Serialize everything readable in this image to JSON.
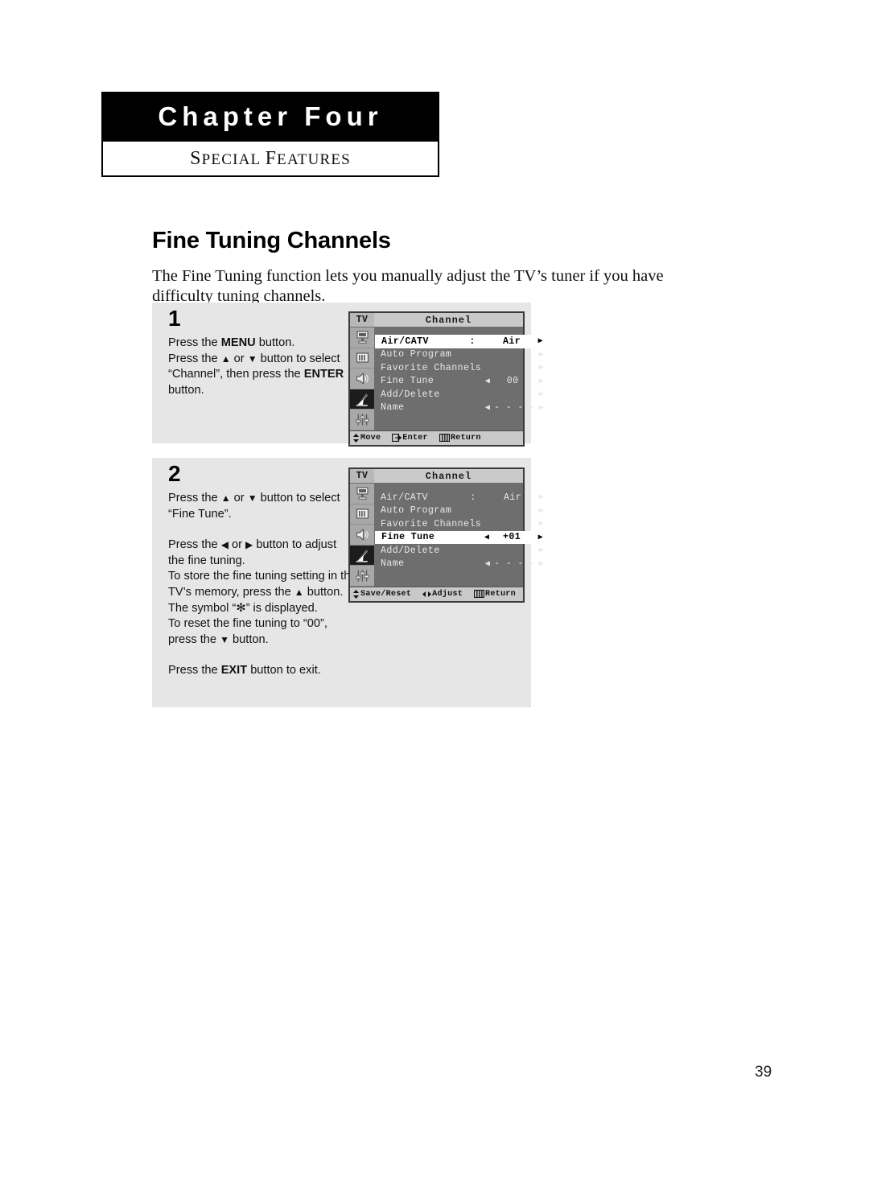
{
  "chapter": {
    "title": "Chapter Four",
    "subtitle_first": "S",
    "subtitle_rest": "PECIAL ",
    "subtitle_first2": "F",
    "subtitle_rest2": "EATURES"
  },
  "page": {
    "title": "Fine Tuning Channels",
    "intro": "The Fine Tuning function lets you manually adjust the TV’s tuner if you have difficulty tuning channels.",
    "number": "39"
  },
  "steps": [
    {
      "number": "1",
      "lines": [
        {
          "parts": [
            {
              "t": "Press the "
            },
            {
              "t": "MENU",
              "b": true
            },
            {
              "t": " button."
            }
          ]
        },
        {
          "parts": [
            {
              "t": "Press the "
            },
            {
              "t": "▲",
              "a": true
            },
            {
              "t": " or "
            },
            {
              "t": "▼",
              "a": true
            },
            {
              "t": " button to select"
            }
          ]
        },
        {
          "parts": [
            {
              "t": "“Channel”, then press the "
            },
            {
              "t": "ENTER",
              "b": true
            }
          ]
        },
        {
          "parts": [
            {
              "t": "button."
            }
          ]
        }
      ]
    },
    {
      "number": "2",
      "lines": [
        {
          "parts": [
            {
              "t": "Press the "
            },
            {
              "t": "▲",
              "a": true
            },
            {
              "t": " or "
            },
            {
              "t": "▼",
              "a": true
            },
            {
              "t": " button to select"
            }
          ]
        },
        {
          "parts": [
            {
              "t": "“Fine Tune”."
            }
          ]
        },
        {
          "gap": true
        },
        {
          "parts": [
            {
              "t": "Press the "
            },
            {
              "t": "◀",
              "a": true
            },
            {
              "t": " or "
            },
            {
              "t": "▶",
              "a": true
            },
            {
              "t": " button to adjust"
            }
          ]
        },
        {
          "parts": [
            {
              "t": "the fine tuning."
            }
          ]
        },
        {
          "parts": [
            {
              "t": "To store the fine tuning setting in the"
            }
          ]
        },
        {
          "parts": [
            {
              "t": "TV’s memory, press the "
            },
            {
              "t": "▲",
              "a": true
            },
            {
              "t": " button."
            }
          ]
        },
        {
          "parts": [
            {
              "t": "The symbol “✻” is displayed."
            }
          ]
        },
        {
          "parts": [
            {
              "t": "To reset the fine tuning to “00”,"
            }
          ]
        },
        {
          "parts": [
            {
              "t": "press the "
            },
            {
              "t": "▼",
              "a": true
            },
            {
              "t": " button."
            }
          ]
        },
        {
          "gap": true
        },
        {
          "parts": [
            {
              "t": "Press the "
            },
            {
              "t": "EXIT",
              "b": true
            },
            {
              "t": " button to exit."
            }
          ]
        }
      ]
    }
  ],
  "osd_menus": [
    {
      "id": "osd-1",
      "tv_tag": "TV",
      "title": "Channel",
      "icons": [
        {
          "name": "monitor-icon",
          "active": false
        },
        {
          "name": "picture-bars-icon",
          "active": false
        },
        {
          "name": "speaker-icon",
          "active": false
        },
        {
          "name": "satellite-dish-icon",
          "active": true
        },
        {
          "name": "sliders-icon",
          "active": false
        }
      ],
      "rows": [
        {
          "label": "Air/CATV",
          "colon": ":",
          "value": "Air",
          "left_arrow": "",
          "right_arrow": "▶",
          "selected": true
        },
        {
          "label": "Auto Program",
          "colon": "",
          "value": "",
          "left_arrow": "",
          "right_arrow": "▶",
          "selected": false
        },
        {
          "label": "Favorite Channels",
          "colon": "",
          "value": "",
          "left_arrow": "",
          "right_arrow": "▶",
          "selected": false
        },
        {
          "label": "Fine Tune",
          "colon": "",
          "value": "00",
          "left_arrow": "◀",
          "right_arrow": "▶",
          "selected": false
        },
        {
          "label": "Add/Delete",
          "colon": "",
          "value": "",
          "left_arrow": "",
          "right_arrow": "▶",
          "selected": false
        },
        {
          "label": "Name",
          "colon": "",
          "value": "- - - -",
          "left_arrow": "◀",
          "right_arrow": "▶",
          "selected": false
        }
      ],
      "footer": [
        {
          "icon": "updown-arrows-icon",
          "label": "Move"
        },
        {
          "icon": "enter-key-icon",
          "label": "Enter"
        },
        {
          "icon": "menu-return-icon",
          "label": "Return"
        }
      ]
    },
    {
      "id": "osd-2",
      "tv_tag": "TV",
      "title": "Channel",
      "icons": [
        {
          "name": "monitor-icon",
          "active": false
        },
        {
          "name": "picture-bars-icon",
          "active": false
        },
        {
          "name": "speaker-icon",
          "active": false
        },
        {
          "name": "satellite-dish-icon",
          "active": true
        },
        {
          "name": "sliders-icon",
          "active": false
        }
      ],
      "rows": [
        {
          "label": "Air/CATV",
          "colon": ":",
          "value": "Air",
          "left_arrow": "",
          "right_arrow": "▶",
          "selected": false
        },
        {
          "label": "Auto Program",
          "colon": "",
          "value": "",
          "left_arrow": "",
          "right_arrow": "▶",
          "selected": false
        },
        {
          "label": "Favorite Channels",
          "colon": "",
          "value": "",
          "left_arrow": "",
          "right_arrow": "▶",
          "selected": false
        },
        {
          "label": "Fine Tune",
          "colon": "",
          "value": "+01",
          "left_arrow": "◀",
          "right_arrow": "▶",
          "selected": true
        },
        {
          "label": "Add/Delete",
          "colon": "",
          "value": "",
          "left_arrow": "",
          "right_arrow": "▶",
          "selected": false
        },
        {
          "label": "Name",
          "colon": "",
          "value": "- - - -",
          "left_arrow": "◀",
          "right_arrow": "▶",
          "selected": false
        }
      ],
      "footer": [
        {
          "icon": "updown-arrows-icon",
          "label": "Save/Reset"
        },
        {
          "icon": "leftright-arrows-icon",
          "label": "Adjust"
        },
        {
          "icon": "menu-return-icon",
          "label": "Return"
        }
      ]
    }
  ],
  "colors": {
    "panel_gray": "#e6e6e6",
    "osd_body": "#6e6e6e",
    "osd_bar": "#c9c9c9",
    "osd_icons": "#a8a8a8",
    "osd_active_icon": "#1c1c1c",
    "selected_row": "#ffffff"
  }
}
